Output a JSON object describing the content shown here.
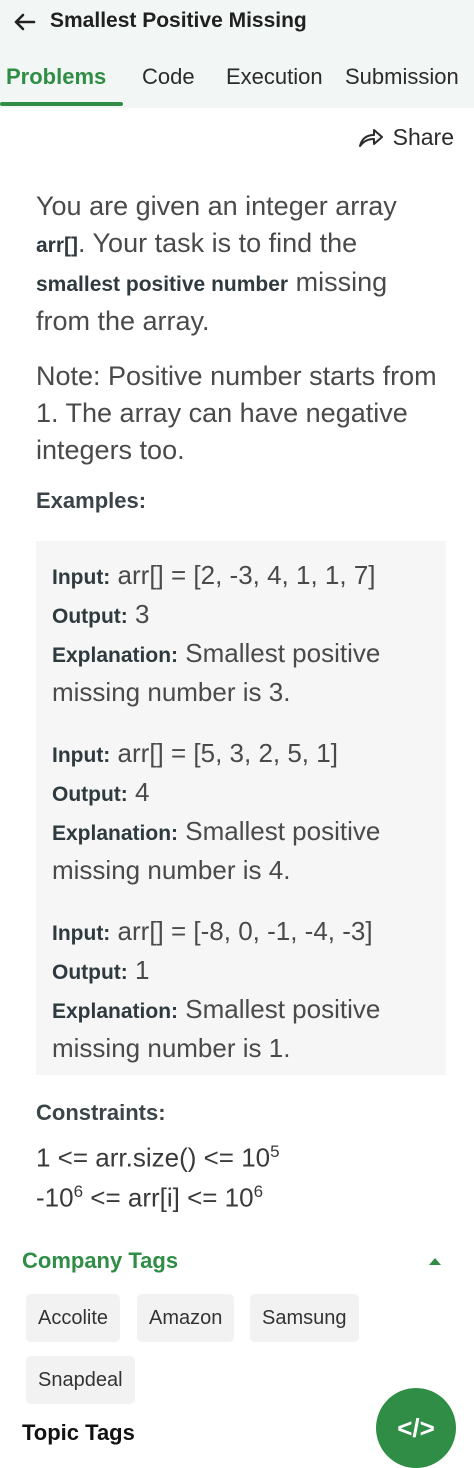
{
  "header": {
    "title": "Smallest Positive Missing",
    "tabs": [
      {
        "label": "Problems"
      },
      {
        "label": "Code"
      },
      {
        "label": "Execution"
      },
      {
        "label": "Submission"
      }
    ]
  },
  "share": {
    "label": "Share"
  },
  "problem": {
    "p1_part1": "You are given an integer array ",
    "p1_bold1": "arr[]",
    "p1_part2": ". Your task is to find the ",
    "p1_bold2": "smallest positive number",
    "p1_part3": " missing from the array.",
    "p2": "Note: Positive number starts from 1. The array can have negative integers too."
  },
  "examples": {
    "heading": "Examples:",
    "input_label": "Input:",
    "output_label": "Output:",
    "explanation_label": "Explanation:",
    "items": [
      {
        "input": "arr[] = [2, -3, 4, 1, 1, 7]",
        "output": "3",
        "explanation": "Smallest positive missing number is 3."
      },
      {
        "input": "arr[] = [5, 3, 2, 5, 1]",
        "output": "4",
        "explanation": "Smallest positive missing number is 4."
      },
      {
        "input": "arr[] = [-8, 0, -1, -4, -3]",
        "output": "1",
        "explanation": "Smallest positive missing number is 1."
      }
    ]
  },
  "constraints": {
    "heading": "Constraints:",
    "c1_main": "1 <= arr.size() <= 10",
    "c1_sup": "5",
    "c2_a": "-10",
    "c2_sup1": "6",
    "c2_b": " <= arr[i] <= 10",
    "c2_sup2": "6"
  },
  "company_tags": {
    "heading": "Company Tags",
    "tags": [
      "Accolite",
      "Amazon",
      "Samsung",
      "Snapdeal"
    ]
  },
  "topic_tags": {
    "heading": "Topic Tags"
  },
  "fab": {
    "label": "</>"
  },
  "colors": {
    "accent": "#2f8d46",
    "topbar_bg": "#f2f6f4",
    "example_bg": "#f6f6f6"
  }
}
